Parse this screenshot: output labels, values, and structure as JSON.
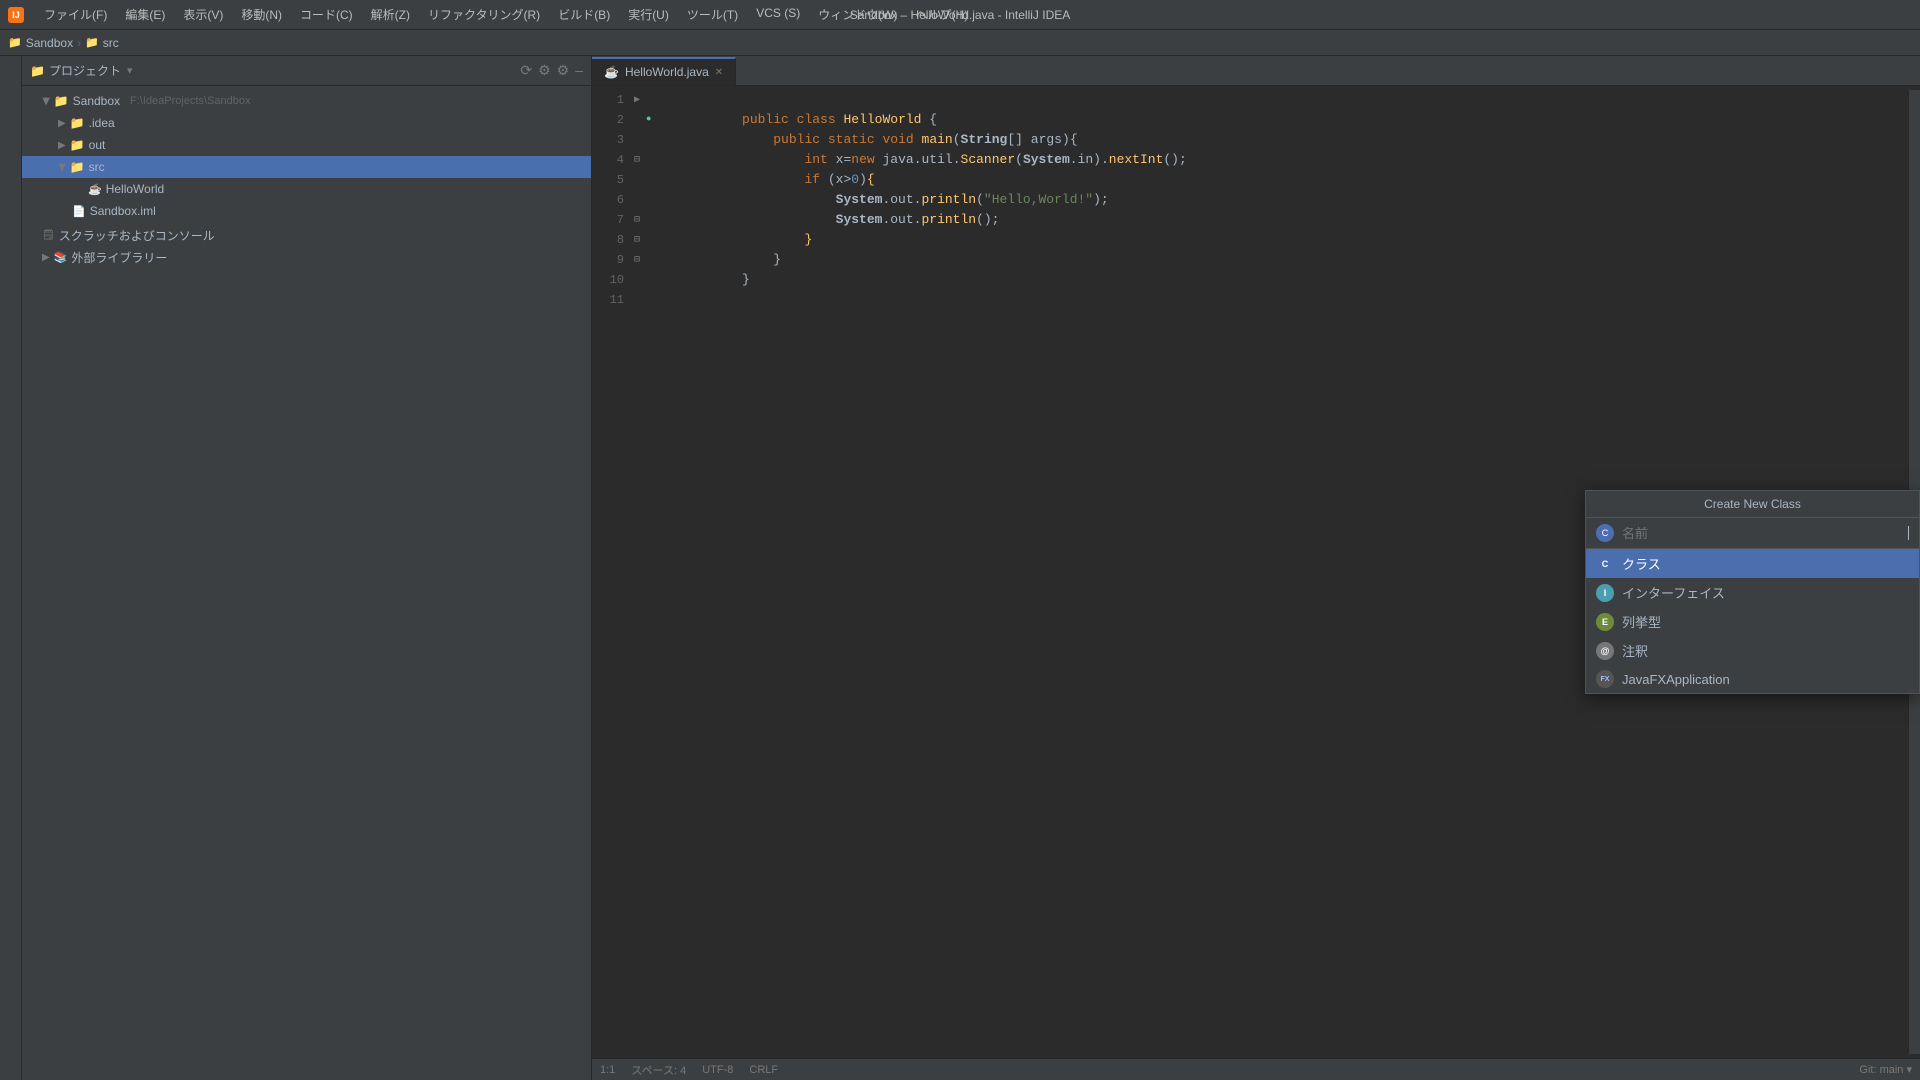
{
  "titlebar": {
    "app_icon": "IJ",
    "title": "Sandbox – HelloWorld.java - IntelliJ IDEA",
    "menus": [
      {
        "label": "ファイル(F)"
      },
      {
        "label": "編集(E)"
      },
      {
        "label": "表示(V)"
      },
      {
        "label": "移動(N)"
      },
      {
        "label": "コード(C)"
      },
      {
        "label": "解析(Z)"
      },
      {
        "label": "リファクタリング(R)"
      },
      {
        "label": "ビルド(B)"
      },
      {
        "label": "実行(U)"
      },
      {
        "label": "ツール(T)"
      },
      {
        "label": "VCS (S)"
      },
      {
        "label": "ウィンドウ(W)"
      },
      {
        "label": "ヘルプ(H)"
      }
    ]
  },
  "breadcrumb": {
    "items": [
      "Sandbox",
      "src"
    ]
  },
  "project_panel": {
    "title": "プロジェクト",
    "tree": [
      {
        "id": "sandbox-root",
        "label": "Sandbox",
        "type": "folder",
        "path": "F:\\IdeaProjects\\Sandbox",
        "indent": 1,
        "open": true
      },
      {
        "id": "idea",
        "label": ".idea",
        "type": "folder",
        "indent": 2,
        "open": false
      },
      {
        "id": "out",
        "label": "out",
        "type": "folder",
        "indent": 2,
        "open": false
      },
      {
        "id": "src",
        "label": "src",
        "type": "folder",
        "indent": 2,
        "open": true,
        "selected": true
      },
      {
        "id": "helloworld",
        "label": "HelloWorld",
        "type": "java",
        "indent": 3
      },
      {
        "id": "sandbox-iml",
        "label": "Sandbox.iml",
        "type": "xml",
        "indent": 2
      },
      {
        "id": "scratches",
        "label": "スクラッチおよびコンソール",
        "type": "scratch",
        "indent": 1
      },
      {
        "id": "external-lib",
        "label": "外部ライブラリー",
        "type": "folder",
        "indent": 1,
        "open": false
      }
    ]
  },
  "editor": {
    "tab": "HelloWorld.java",
    "lines": [
      {
        "num": 1,
        "content": "public class HelloWorld {",
        "type": "code"
      },
      {
        "num": 2,
        "content": "    public static void main(String[] args){",
        "type": "code"
      },
      {
        "num": 3,
        "content": "        int x=new java.util.Scanner(System.in).nextInt();",
        "type": "code"
      },
      {
        "num": 4,
        "content": "        if (x>0){",
        "type": "code"
      },
      {
        "num": 5,
        "content": "            System.out.println(\"Hello,World!\");",
        "type": "code"
      },
      {
        "num": 6,
        "content": "            System.out.println();",
        "type": "code"
      },
      {
        "num": 7,
        "content": "        }",
        "type": "code"
      },
      {
        "num": 8,
        "content": "    }",
        "type": "code"
      },
      {
        "num": 9,
        "content": "}",
        "type": "code"
      },
      {
        "num": 10,
        "content": "",
        "type": "empty"
      },
      {
        "num": 11,
        "content": "",
        "type": "empty"
      }
    ]
  },
  "create_new_class": {
    "title": "Create New Class",
    "input_placeholder": "名前",
    "items": [
      {
        "id": "class",
        "label": "クラス",
        "icon_type": "class",
        "icon_letter": "C"
      },
      {
        "id": "interface",
        "label": "インターフェイス",
        "icon_type": "interface",
        "icon_letter": "I"
      },
      {
        "id": "enum",
        "label": "列挙型",
        "icon_type": "enum",
        "icon_letter": "E"
      },
      {
        "id": "annotation",
        "label": "注釈",
        "icon_type": "annotation",
        "icon_letter": "@"
      },
      {
        "id": "javafx",
        "label": "JavaFXApplication",
        "icon_type": "javafx",
        "icon_letter": "FX"
      }
    ]
  },
  "bottom_bar": {
    "line_col": "1:1",
    "encoding": "UTF-8",
    "line_sep": "CRLF",
    "spaces": "スペース: 4"
  }
}
